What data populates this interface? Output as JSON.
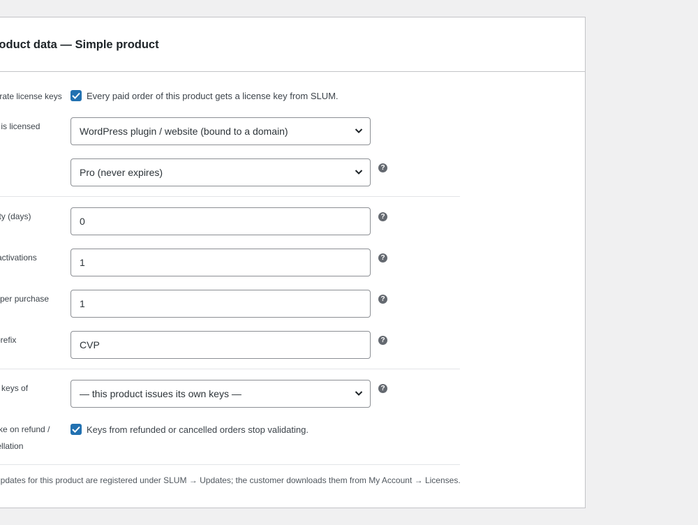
{
  "panel": {
    "title": "Product data — Simple product"
  },
  "fields": {
    "license_keys": {
      "label": "Generate license keys",
      "checkbox_checked": true,
      "description": "Every paid order of this product gets a license key from SLUM."
    },
    "licensed_item": {
      "label": "What is licensed",
      "selected": "WordPress plugin / website (bound to a domain)"
    },
    "license_tier": {
      "label": "",
      "selected": "Pro (never expires)"
    },
    "validity_days": {
      "label": "Validity (days)",
      "value": "0"
    },
    "max_activations": {
      "label": "Max activations",
      "value": "1"
    },
    "keys_per_purchase": {
      "label": "Keys per purchase",
      "value": "1"
    },
    "key_prefix": {
      "label": "Key prefix",
      "value": "CVP"
    },
    "bundle_parent": {
      "label_line1": "Issue keys of",
      "label_line2": "",
      "selected": "— this product issues its own keys —"
    },
    "revoke_on_refund": {
      "label_line1": "Revoke on refund /",
      "label_line2": "cancellation",
      "checkbox_checked": true,
      "description": "Keys from refunded or cancelled orders stop validating."
    }
  },
  "footnote": "Updates for this product are registered under SLUM → Updates; the customer downloads them from My Account → Licenses.",
  "icons": {
    "help": "question-circle-icon",
    "dropdown": "chevron-down-icon",
    "check": "checkmark-icon"
  },
  "colors": {
    "accent": "#2271b1",
    "border": "#8c8f94",
    "background": "#f0f0f1"
  }
}
